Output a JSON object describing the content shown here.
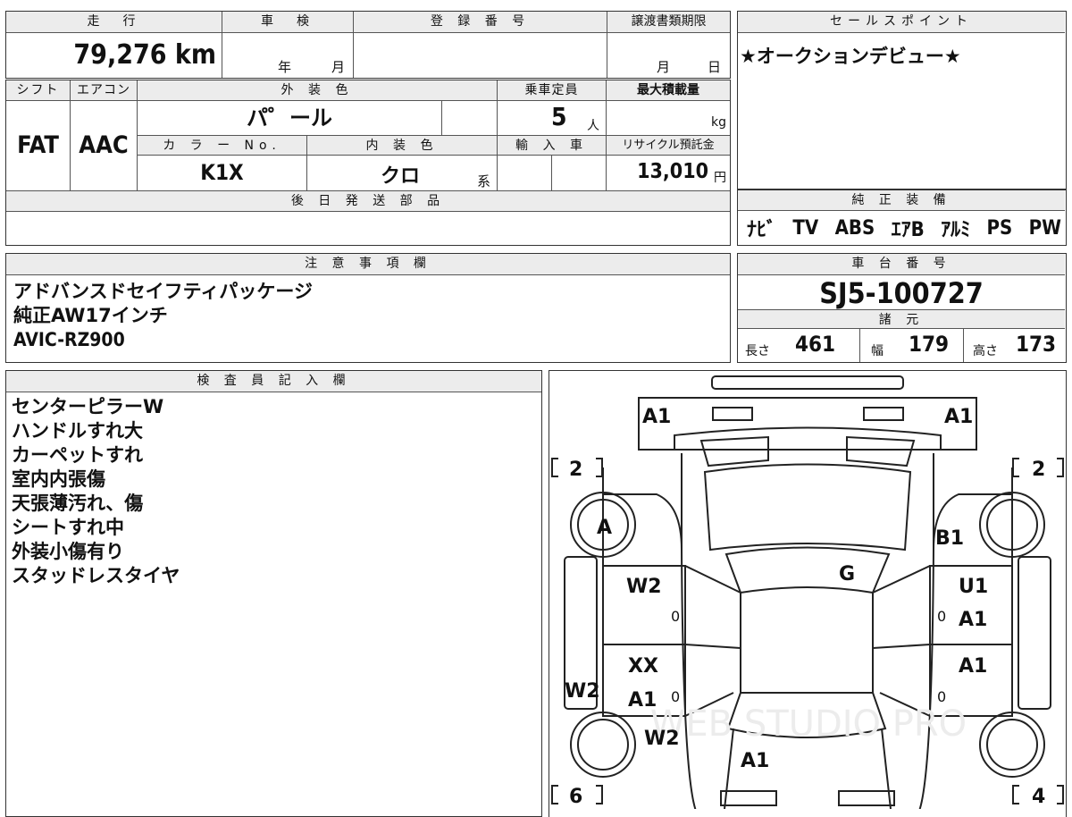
{
  "top_row": {
    "mileage_header": "走　行",
    "mileage_value": "79,276 km",
    "shaken_header": "車　検",
    "shaken_year": "年",
    "shaken_month": "月",
    "reg_header": "登 録 番 号",
    "transfer_header": "譲渡書類期限",
    "transfer_month": "月",
    "transfer_day": "日"
  },
  "mid_row": {
    "shift_header": "シフト",
    "shift_value": "FAT",
    "ac_header": "エアコン",
    "ac_value": "AAC",
    "exterior_header": "外 装 色",
    "exterior_value": "パ゜ール",
    "capacity_header": "乗車定員",
    "capacity_value": "5",
    "capacity_unit": "人",
    "max_load_header": "最大積載量",
    "max_load_unit": "kg",
    "color_no_header": "カ ラ ー No.",
    "color_no_value": "K1X",
    "interior_header": "内 装 色",
    "interior_value": "クロ",
    "interior_suffix": "系",
    "import_header": "輸 入 車",
    "recycle_header": "リサイクル預託金",
    "recycle_value": "13,010",
    "recycle_unit": "円",
    "later_parts_header": "後 日 発 送 部 品"
  },
  "sales_point": {
    "header": "セールスポイント",
    "text": "★オークションデビュー★"
  },
  "equipment": {
    "header": "純 正 装 備",
    "items": [
      "ﾅﾋﾞ",
      "TV",
      "ABS",
      "ｴｱB",
      "ｱﾙﾐ",
      "PS",
      "PW"
    ]
  },
  "notes": {
    "header": "注 意 事 項 欄",
    "lines": [
      "アドバンスドセイフティパッケージ",
      "純正AW17インチ",
      "AVIC-RZ900"
    ]
  },
  "chassis": {
    "header": "車 台 番 号",
    "value": "SJ5-100727"
  },
  "specs": {
    "header": "諸 元",
    "length_label": "長さ",
    "length_value": "461",
    "width_label": "幅",
    "width_value": "179",
    "height_label": "高さ",
    "height_value": "173"
  },
  "inspector": {
    "header": "検 査 員 記 入 欄",
    "lines": [
      "センターピラーW",
      "ハンドルすれ大",
      "カーペットすれ",
      "室内内張傷",
      "天張薄汚れ、傷",
      "シートすれ中",
      "外装小傷有り",
      "スタッドレスタイヤ"
    ]
  },
  "diagram": {
    "marks": {
      "front_left": "A1",
      "front_right": "A1",
      "tire_left_front": "2",
      "tire_right_front": "2",
      "tire_left_rear": "6",
      "tire_right_rear": "4",
      "left_fender": "A",
      "right_fender": "B1",
      "roof": "G",
      "left_front_door": "W2",
      "right_front_door_1": "U1",
      "right_front_door_2": "A1",
      "left_rear_door_1": "XX",
      "left_rear_door_2": "A1",
      "right_rear_door": "A1",
      "left_sill": "W2",
      "left_rear_quarter": "W2",
      "rear": "A1",
      "zero_a": "0",
      "zero_b": "0",
      "zero_c": "0",
      "zero_d": "0"
    },
    "watermark": "WEB STUDIO PRO"
  }
}
